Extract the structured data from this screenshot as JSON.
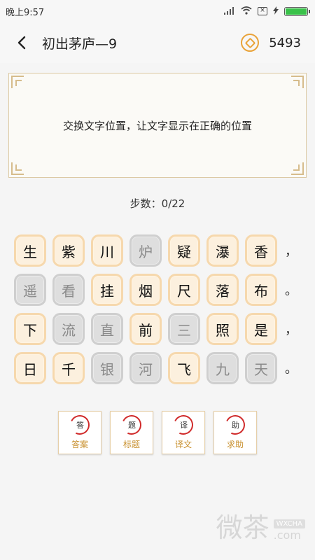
{
  "status": {
    "time": "晚上9:57",
    "sim": "×",
    "battery_level": 1.0
  },
  "header": {
    "title": "初出茅庐—9",
    "coins": "5493"
  },
  "panel": {
    "instruction": "交换文字位置，让文字显示在正确的位置"
  },
  "steps": "步数：0/22",
  "grid": [
    {
      "tiles": [
        {
          "char": "生",
          "state": "active"
        },
        {
          "char": "紫",
          "state": "active"
        },
        {
          "char": "川",
          "state": "active"
        },
        {
          "char": "炉",
          "state": "done"
        },
        {
          "char": "疑",
          "state": "active"
        },
        {
          "char": "瀑",
          "state": "active"
        },
        {
          "char": "香",
          "state": "active"
        }
      ],
      "punct": "，"
    },
    {
      "tiles": [
        {
          "char": "遥",
          "state": "done"
        },
        {
          "char": "看",
          "state": "done"
        },
        {
          "char": "挂",
          "state": "active"
        },
        {
          "char": "烟",
          "state": "active"
        },
        {
          "char": "尺",
          "state": "active"
        },
        {
          "char": "落",
          "state": "active"
        },
        {
          "char": "布",
          "state": "active"
        }
      ],
      "punct": "。"
    },
    {
      "tiles": [
        {
          "char": "下",
          "state": "active"
        },
        {
          "char": "流",
          "state": "done"
        },
        {
          "char": "直",
          "state": "done"
        },
        {
          "char": "前",
          "state": "active"
        },
        {
          "char": "三",
          "state": "done"
        },
        {
          "char": "照",
          "state": "active"
        },
        {
          "char": "是",
          "state": "active"
        }
      ],
      "punct": "，"
    },
    {
      "tiles": [
        {
          "char": "日",
          "state": "active"
        },
        {
          "char": "千",
          "state": "active"
        },
        {
          "char": "银",
          "state": "done"
        },
        {
          "char": "河",
          "state": "done"
        },
        {
          "char": "飞",
          "state": "active"
        },
        {
          "char": "九",
          "state": "done"
        },
        {
          "char": "天",
          "state": "done"
        }
      ],
      "punct": "。"
    }
  ],
  "tools": [
    {
      "seal": "答",
      "label": "答案"
    },
    {
      "seal": "题",
      "label": "标题"
    },
    {
      "seal": "译",
      "label": "译文"
    },
    {
      "seal": "助",
      "label": "求助"
    }
  ],
  "watermark": {
    "big": "微茶",
    "tag": "WXCHA",
    "domain": ".com"
  },
  "colors": {
    "tile_active_bg": "#fcf0de",
    "tile_done_bg": "#dedede",
    "accent_gold": "#e9a33a",
    "seal_red": "#d02a2a"
  }
}
